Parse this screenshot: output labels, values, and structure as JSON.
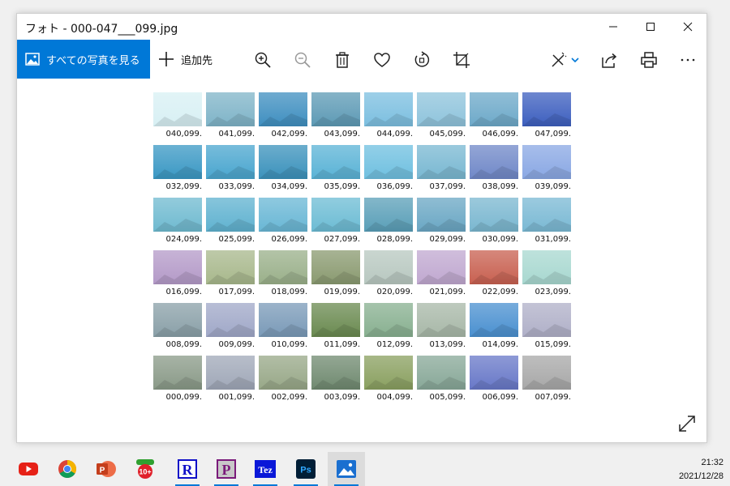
{
  "window": {
    "title": "フォト - 000-047___099.jpg"
  },
  "toolbar": {
    "all_photos_label": "すべての写真を見る",
    "add_label": "追加先"
  },
  "captions": [
    [
      "040,099.",
      "041,099.",
      "042,099.",
      "043,099.",
      "044,099.",
      "045,099.",
      "046,099.",
      "047,099."
    ],
    [
      "032,099.",
      "033,099.",
      "034,099.",
      "035,099.",
      "036,099.",
      "037,099.",
      "038,099.",
      "039,099."
    ],
    [
      "024,099.",
      "025,099.",
      "026,099.",
      "027,099.",
      "028,099.",
      "029,099.",
      "030,099.",
      "031,099."
    ],
    [
      "016,099.",
      "017,099.",
      "018,099.",
      "019,099.",
      "020,099.",
      "021,099.",
      "022,099.",
      "023,099."
    ],
    [
      "008,099.",
      "009,099.",
      "010,099.",
      "011,099.",
      "012,099.",
      "013,099.",
      "014,099.",
      "015,099."
    ],
    [
      "000,099.",
      "001,099.",
      "002,099.",
      "003,099.",
      "004,099.",
      "005,099.",
      "006,099.",
      "007,099."
    ]
  ],
  "thumb_colors": [
    [
      "#d8f0f4",
      "#7fb4c8",
      "#3f8fc0",
      "#5d9ab5",
      "#7cbfe0",
      "#8fc4dc",
      "#6da9c9",
      "#3d5fbf"
    ],
    [
      "#3a98c4",
      "#4aa6cf",
      "#3b92bc",
      "#5ab3d6",
      "#6fc0e0",
      "#79b8d2",
      "#7088c8",
      "#8aa8e4"
    ],
    [
      "#6fbad0",
      "#5fb2d0",
      "#69b7d5",
      "#6cbcd4",
      "#5a9fb8",
      "#6aa7c4",
      "#7ab7d0",
      "#7ab9d4"
    ],
    [
      "#b49ac8",
      "#a8b88c",
      "#9ab08a",
      "#8a9a70",
      "#b8c8c0",
      "#c0a8d0",
      "#c86050",
      "#a8d8d0"
    ],
    [
      "#8aa0a8",
      "#a0a8c8",
      "#7a9ab8",
      "#6a8a50",
      "#88b090",
      "#a8b8a8",
      "#4a90d0",
      "#b0b0c8"
    ],
    [
      "#8a9a88",
      "#a0a8b8",
      "#98a888",
      "#708a70",
      "#8aa060",
      "#88a898",
      "#6878c8",
      "#a8a8a8"
    ]
  ],
  "taskbar": {
    "apps": [
      "youtube-icon",
      "chrome-icon",
      "powerpoint-icon",
      "10plus-icon",
      "r-app-icon",
      "p-app-icon",
      "tez-app-icon",
      "photoshop-icon",
      "photos-icon"
    ],
    "r_label": "R",
    "p_label": "P",
    "tez_label": "Tez",
    "ps_label": "Ps",
    "badge_label": "10+"
  },
  "clock": {
    "time": "21:32",
    "date": "2021/12/28"
  }
}
